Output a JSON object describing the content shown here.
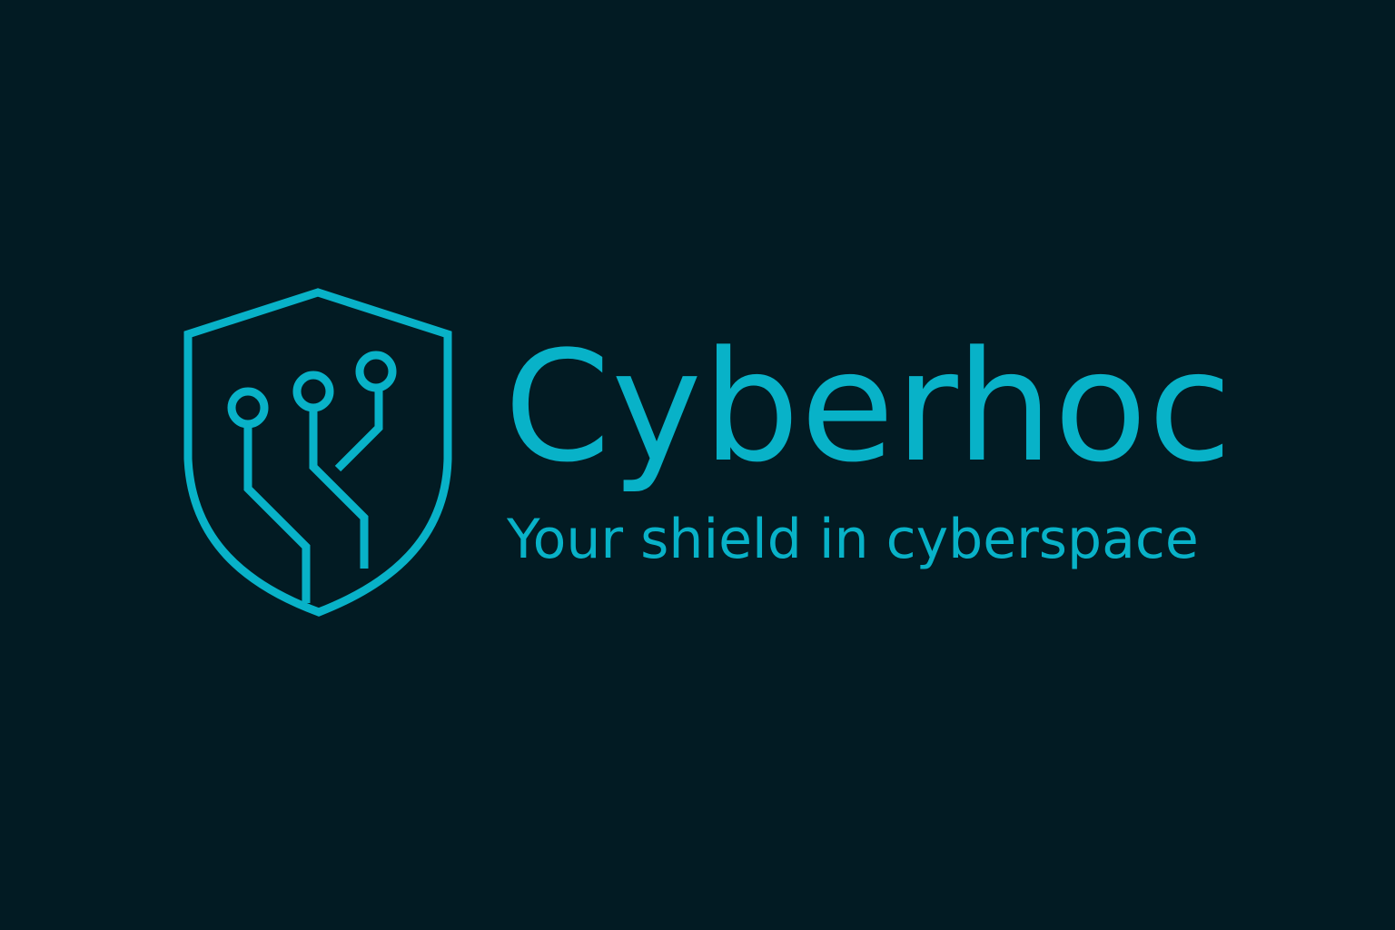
{
  "brand": {
    "name": "Cyberhoc",
    "tagline": "Your shield in cyberspace",
    "icon": "shield-circuit-icon"
  },
  "colors": {
    "background": "#021b23",
    "accent": "#08b2c8"
  }
}
